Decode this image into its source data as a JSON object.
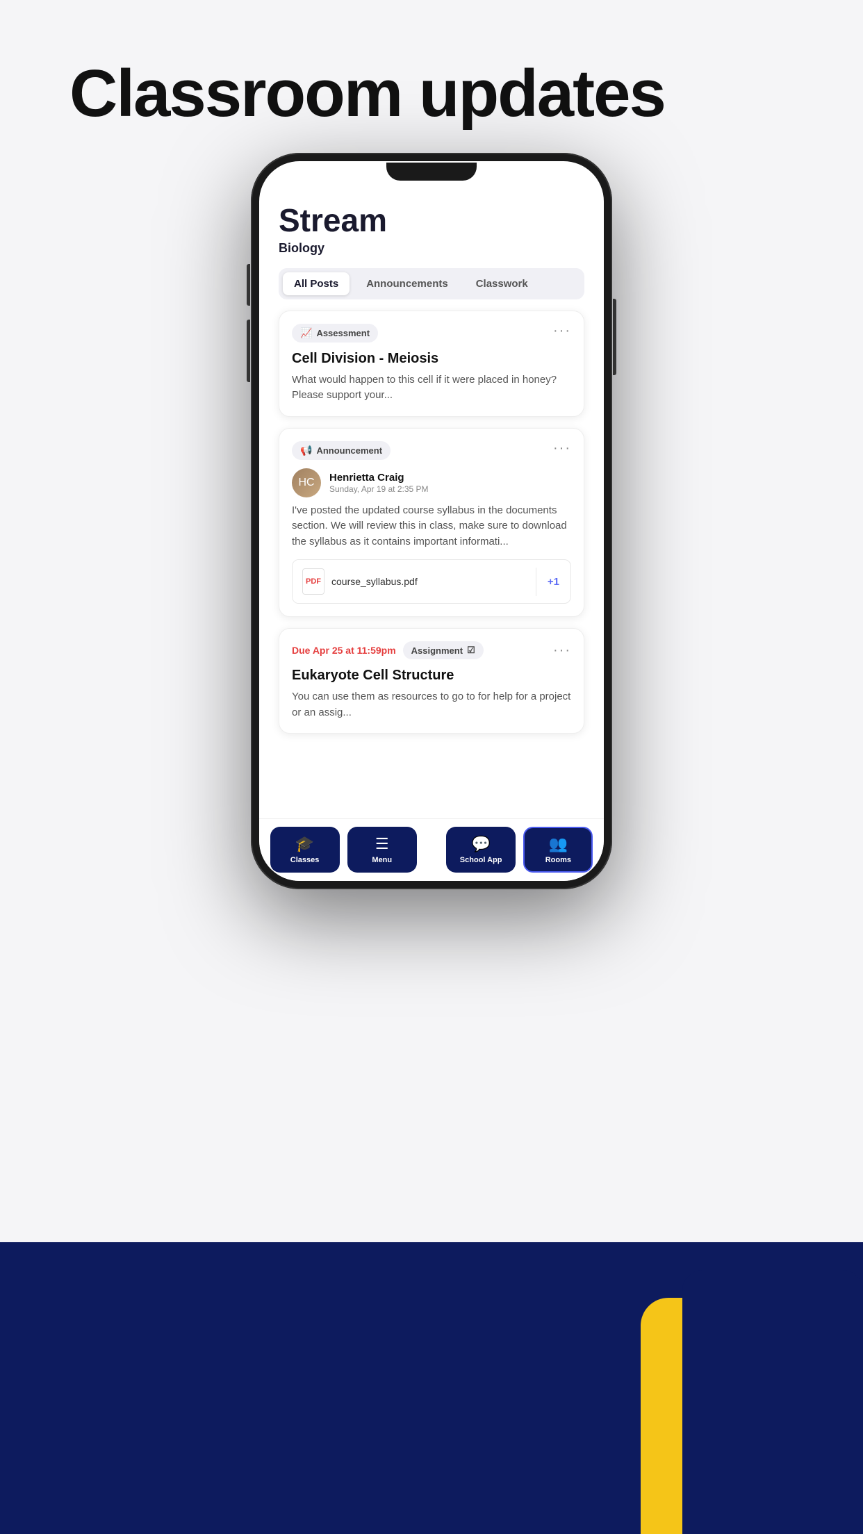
{
  "page": {
    "title": "Classroom updates",
    "background_color": "#f5f5f7"
  },
  "phone": {
    "screen": {
      "stream_title": "Stream",
      "stream_subtitle": "Biology",
      "tabs": [
        {
          "label": "All Posts",
          "active": true
        },
        {
          "label": "Announcements",
          "active": false
        },
        {
          "label": "Classwork",
          "active": false
        }
      ],
      "cards": [
        {
          "type": "assessment",
          "tag": "Assessment",
          "tag_icon": "📈",
          "title": "Cell Division - Meiosis",
          "body": "What would happen to this cell if it were placed in honey? Please support your..."
        },
        {
          "type": "announcement",
          "tag": "Announcement",
          "tag_icon": "📢",
          "user_name": "Henrietta Craig",
          "user_time": "Sunday, Apr 19 at 2:35 PM",
          "body": "I've posted the updated course syllabus in the documents section. We will review this in class, make sure to download the syllabus as it contains important informati...",
          "attachment_name": "course_syllabus.pdf",
          "attachment_extra": "+1"
        },
        {
          "type": "assignment",
          "tag": "Assignment",
          "tag_icon": "☑",
          "due_label": "Due Apr 25 at 11:59pm",
          "title": "Eukaryote Cell Structure",
          "body": "You can use them as resources to go to for help for a project or an assig..."
        }
      ]
    },
    "nav": {
      "items": [
        {
          "label": "Classes",
          "icon": "🎓",
          "active": true
        },
        {
          "label": "Menu",
          "icon": "☰",
          "active": false
        },
        {
          "label": "School App",
          "icon": "💬",
          "active": false
        },
        {
          "label": "Rooms",
          "icon": "👥",
          "active": true
        }
      ]
    }
  }
}
